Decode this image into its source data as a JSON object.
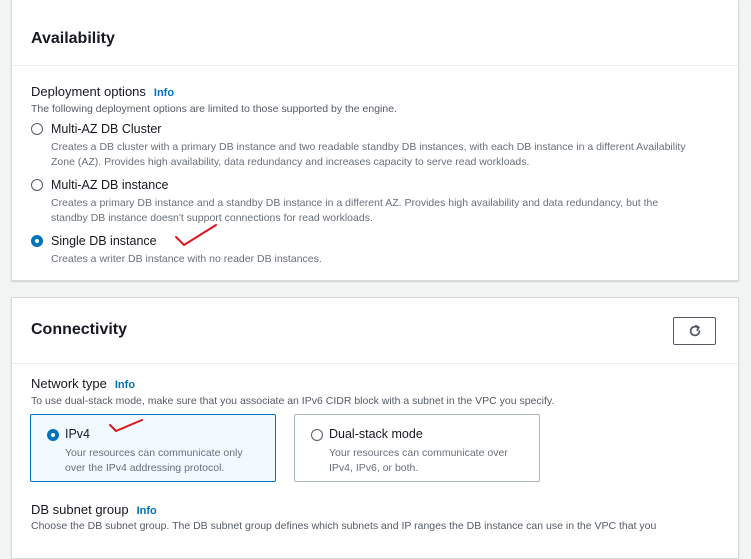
{
  "availability": {
    "title": "Availability",
    "deployment_label": "Deployment options",
    "info": "Info",
    "deployment_desc": "The following deployment options are limited to those supported by the engine.",
    "options": [
      {
        "label": "Multi-AZ DB Cluster",
        "desc_line1": "Creates a DB cluster with a primary DB instance and two readable standby DB instances, with each DB instance in a different Availability",
        "desc_line2": "Zone (AZ). Provides high availability, data redundancy and increases capacity to serve read workloads.",
        "selected": false
      },
      {
        "label": "Multi-AZ DB instance",
        "desc_line1": "Creates a primary DB instance and a standby DB instance in a different AZ. Provides high availability and data redundancy, but the",
        "desc_line2": "standby DB instance doesn't support connections for read workloads.",
        "selected": false
      },
      {
        "label": "Single DB instance",
        "desc_line1": "Creates a writer DB instance with no reader DB instances.",
        "desc_line2": "",
        "selected": true
      }
    ]
  },
  "connectivity": {
    "title": "Connectivity",
    "refresh_icon": "refresh-icon",
    "network_type_label": "Network type",
    "info": "Info",
    "network_type_desc": "To use dual-stack mode, make sure that you associate an IPv6 CIDR block with a subnet in the VPC you specify.",
    "network_options": [
      {
        "label": "IPv4",
        "desc_line1": "Your resources can communicate only",
        "desc_line2": "over the IPv4 addressing protocol.",
        "selected": true
      },
      {
        "label": "Dual-stack mode",
        "desc_line1": "Your resources can communicate over",
        "desc_line2": "IPv4, IPv6, or both.",
        "selected": false
      }
    ],
    "subnet_label": "DB subnet group",
    "subnet_info": "Info",
    "subnet_desc": "Choose the DB subnet group. The DB subnet group defines which subnets and IP ranges the DB instance can use in the VPC that you"
  },
  "colors": {
    "accent": "#0073bb",
    "annotation": "#e0141e"
  }
}
